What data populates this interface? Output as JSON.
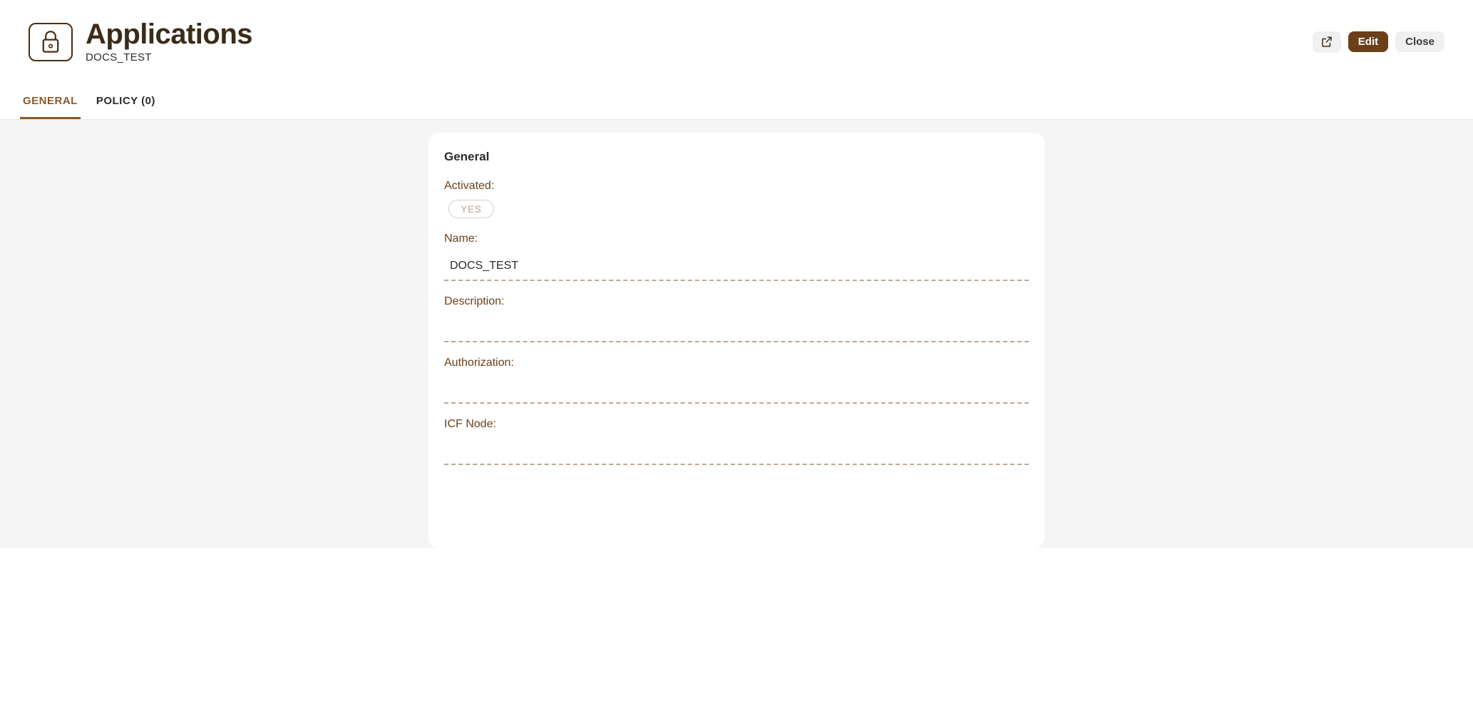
{
  "header": {
    "title": "Applications",
    "subtitle": "DOCS_TEST",
    "actions": {
      "share_icon": "share-icon",
      "edit_label": "Edit",
      "close_label": "Close"
    }
  },
  "tabs": [
    {
      "label": "GENERAL",
      "active": true
    },
    {
      "label": "POLICY (0)",
      "active": false
    }
  ],
  "card": {
    "title": "General",
    "fields": {
      "activated": {
        "label": "Activated:",
        "value": "YES"
      },
      "name": {
        "label": "Name:",
        "value": "DOCS_TEST"
      },
      "description": {
        "label": "Description:",
        "value": ""
      },
      "authorization": {
        "label": "Authorization:",
        "value": ""
      },
      "icf_node": {
        "label": "ICF Node:",
        "value": ""
      }
    }
  }
}
